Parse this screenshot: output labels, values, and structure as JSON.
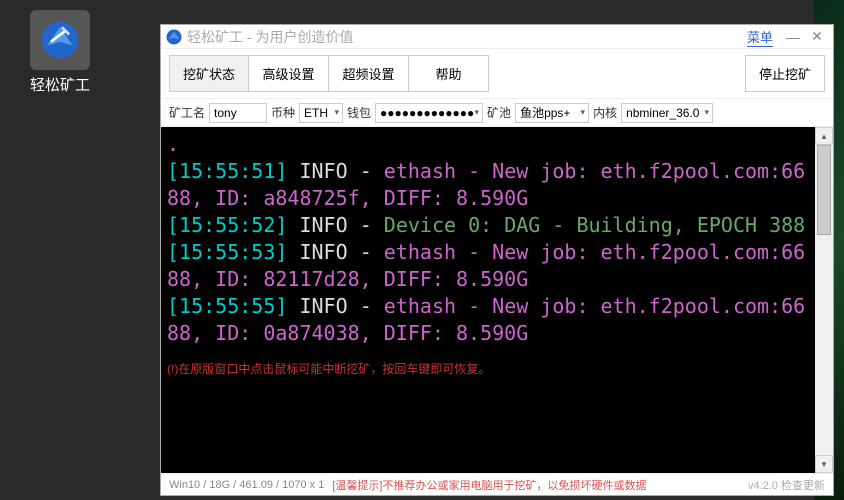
{
  "desktop": {
    "icon_label": "轻松矿工"
  },
  "window": {
    "title": "轻松矿工 - 为用户创造价值",
    "menu_label": "菜单"
  },
  "tabs": {
    "mining_status": "挖矿状态",
    "advanced": "高级设置",
    "overclock": "超频设置",
    "help": "帮助",
    "stop": "停止挖矿"
  },
  "config": {
    "miner_label": "矿工名",
    "miner_value": "tony",
    "coin_label": "币种",
    "coin_value": "ETH",
    "wallet_label": "钱包",
    "wallet_value": "●●●●●●●●●●●●●",
    "pool_label": "矿池",
    "pool_value": "鱼池pps+",
    "kernel_label": "内核",
    "kernel_value": "nbminer_36.0"
  },
  "log": {
    "l1_time": "[15:55:51]",
    "l1_info": "INFO",
    "l1_msg": "ethash - New job: eth.f2pool.com:6688, ID: a848725f, DIFF: 8.590G",
    "l2_time": "[15:55:52]",
    "l2_info": "INFO",
    "l2_msg": "Device 0: DAG - Building, EPOCH 388",
    "l3_time": "[15:55:53]",
    "l3_info": "INFO",
    "l3_msg": "ethash - New job: eth.f2pool.com:6688, ID: 82117d28, DIFF: 8.590G",
    "l4_time": "[15:55:55]",
    "l4_info": "INFO",
    "l4_msg": "ethash - New job: eth.f2pool.com:6688, ID: 0a874038, DIFF: 8.590G",
    "warn": "(!)在原版窗口中点击鼠标可能中断挖矿，按回车键即可恢复。"
  },
  "status": {
    "sys": "Win10 / 18G / 461.09 / 1070 x 1",
    "hint": "[温馨提示]不推荐办公或家用电脑用于挖矿，以免损坏硬件或数据",
    "version": "v4.2.0 检查更新"
  }
}
